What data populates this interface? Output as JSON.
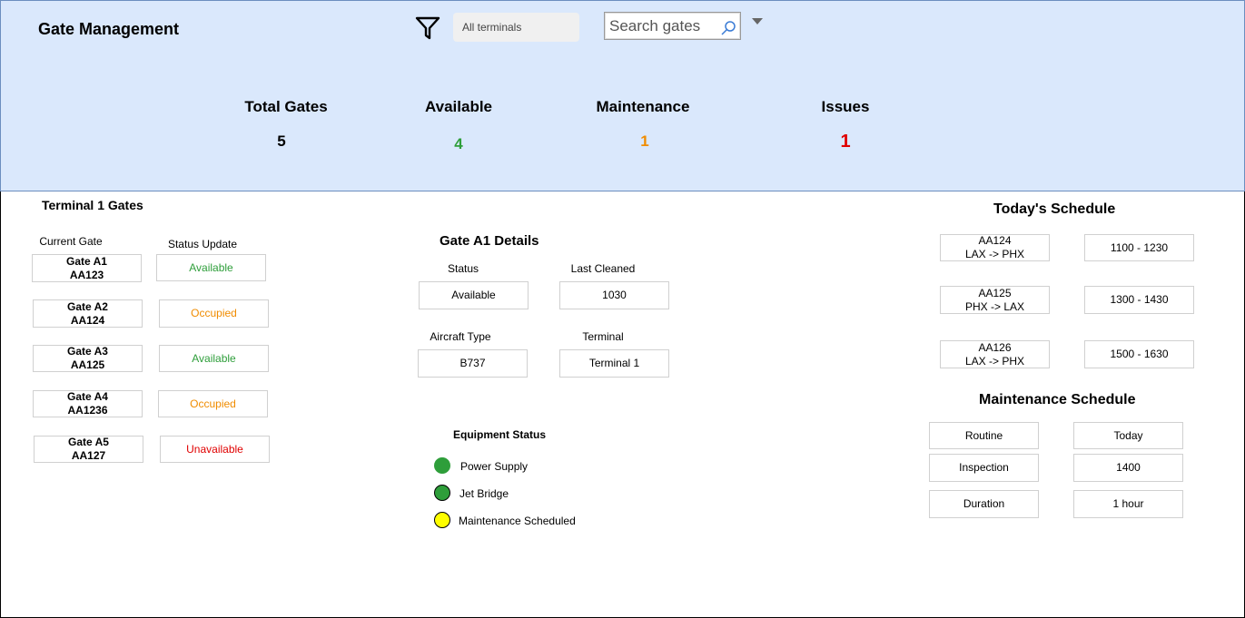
{
  "app": {
    "title": "Gate Management"
  },
  "toolbar": {
    "filter_icon": "filter-icon",
    "terminal_select": "All terminals",
    "search_placeholder": "Search gates",
    "search_icon": "search-icon"
  },
  "stats": [
    {
      "label": "Total Gates",
      "value": "5",
      "color": "#000000"
    },
    {
      "label": "Available",
      "value": "4",
      "color": "#2e9e3a"
    },
    {
      "label": "Maintenance",
      "value": "1",
      "color": "#f08c00"
    },
    {
      "label": "Issues",
      "value": "1",
      "color": "#e00000"
    }
  ],
  "terminal": {
    "title": "Terminal 1 Gates",
    "col_current": "Current Gate",
    "col_status": "Status Update",
    "gates": [
      {
        "gate": "Gate A1",
        "flight": "AA123",
        "status": "Available"
      },
      {
        "gate": "Gate A2",
        "flight": "AA124",
        "status": "Occupied"
      },
      {
        "gate": "Gate A3",
        "flight": "AA125",
        "status": "Available"
      },
      {
        "gate": "Gate A4",
        "flight": "AA1236",
        "status": "Occupied"
      },
      {
        "gate": "Gate A5",
        "flight": "AA127",
        "status": "Unavailable"
      }
    ]
  },
  "details": {
    "title": "Gate A1 Details",
    "status_label": "Status",
    "status_value": "Available",
    "cleaned_label": "Last Cleaned",
    "cleaned_value": "1030",
    "aircraft_label": "Aircraft Type",
    "aircraft_value": "B737",
    "terminal_label": "Terminal",
    "terminal_value": "Terminal 1",
    "equipment_title": "Equipment Status",
    "equipment": [
      {
        "name": "Power Supply",
        "color": "#2e9e3a"
      },
      {
        "name": "Jet Bridge",
        "color": "#2e9e3a"
      },
      {
        "name": "Maintenance Scheduled",
        "color": "#ffff00"
      }
    ]
  },
  "schedule": {
    "title": "Today's Schedule",
    "flights": [
      {
        "flight": "AA124",
        "route": "LAX -> PHX",
        "time": "1100 - 1230"
      },
      {
        "flight": "AA125",
        "route": "PHX -> LAX",
        "time": "1300 - 1430"
      },
      {
        "flight": "AA126",
        "route": "LAX -> PHX",
        "time": "1500 - 1630"
      }
    ]
  },
  "maintenance": {
    "title": "Maintenance Schedule",
    "rows": [
      {
        "label": "Routine",
        "value": "Today"
      },
      {
        "label": "Inspection",
        "value": "1400"
      },
      {
        "label": "Duration",
        "value": "1 hour"
      }
    ]
  }
}
